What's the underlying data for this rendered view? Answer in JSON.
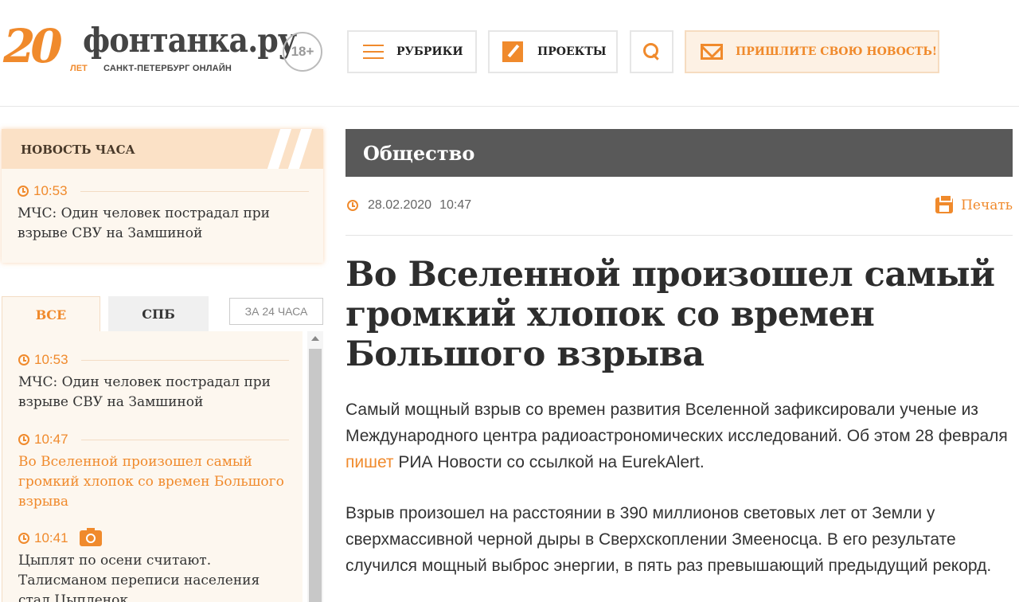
{
  "brand": {
    "logo_number": "20",
    "logo_years": "ЛЕТ",
    "logo_name": "фонтанка.ру",
    "logo_subtitle": "САНКТ-ПЕТЕРБУРГ ОНЛАЙН",
    "age_rating": "18+",
    "accent_color": "#f08a2c"
  },
  "header": {
    "rubrics_label": "РУБРИКИ",
    "projects_label": "ПРОЕКТЫ",
    "send_news_label": "ПРИШЛИТЕ СВОЮ НОВОСТЬ!"
  },
  "sidebar": {
    "hour_news": {
      "heading": "НОВОСТЬ ЧАСА",
      "time": "10:53",
      "text": "МЧС: Один человек пострадал при взрыве СВУ на Замшиной"
    },
    "tabs": {
      "all": "ВСЕ",
      "spb": "СПБ",
      "day": "ЗА 24 ЧАСА"
    },
    "feed": [
      {
        "time": "10:53",
        "text": "МЧС: Один человек пострадал при взрыве СВУ на Замшиной"
      },
      {
        "time": "10:47",
        "text": "Во Вселенной произошел самый громкий хлопок со времен Большого взрыва"
      },
      {
        "time": "10:41",
        "text": "Цыплят по осени считают. Талисманом переписи населения стал Цыпленок"
      }
    ]
  },
  "article": {
    "rubric": "Общество",
    "date": "28.02.2020",
    "time": "10:47",
    "print_label": "Печать",
    "title": "Во Вселенной произошел самый громкий хлопок со времен Большого взрыва",
    "p1_before": "Самый мощный взрыв со времен развития Вселенной зафиксировали ученые из Международного центра радиоастрономических исследований. Об этом 28 февраля ",
    "p1_link": "пишет",
    "p1_after": " РИА Новости со ссылкой на EurekAlert.",
    "p2": "Взрыв произошел на расстоянии в 390 миллионов световых лет от Земли у сверхмассивной черной дыры в Сверхскоплении Змееносца. В его результате случился мощный выброс энергии, в пять раз превышающий предыдущий рекорд."
  }
}
